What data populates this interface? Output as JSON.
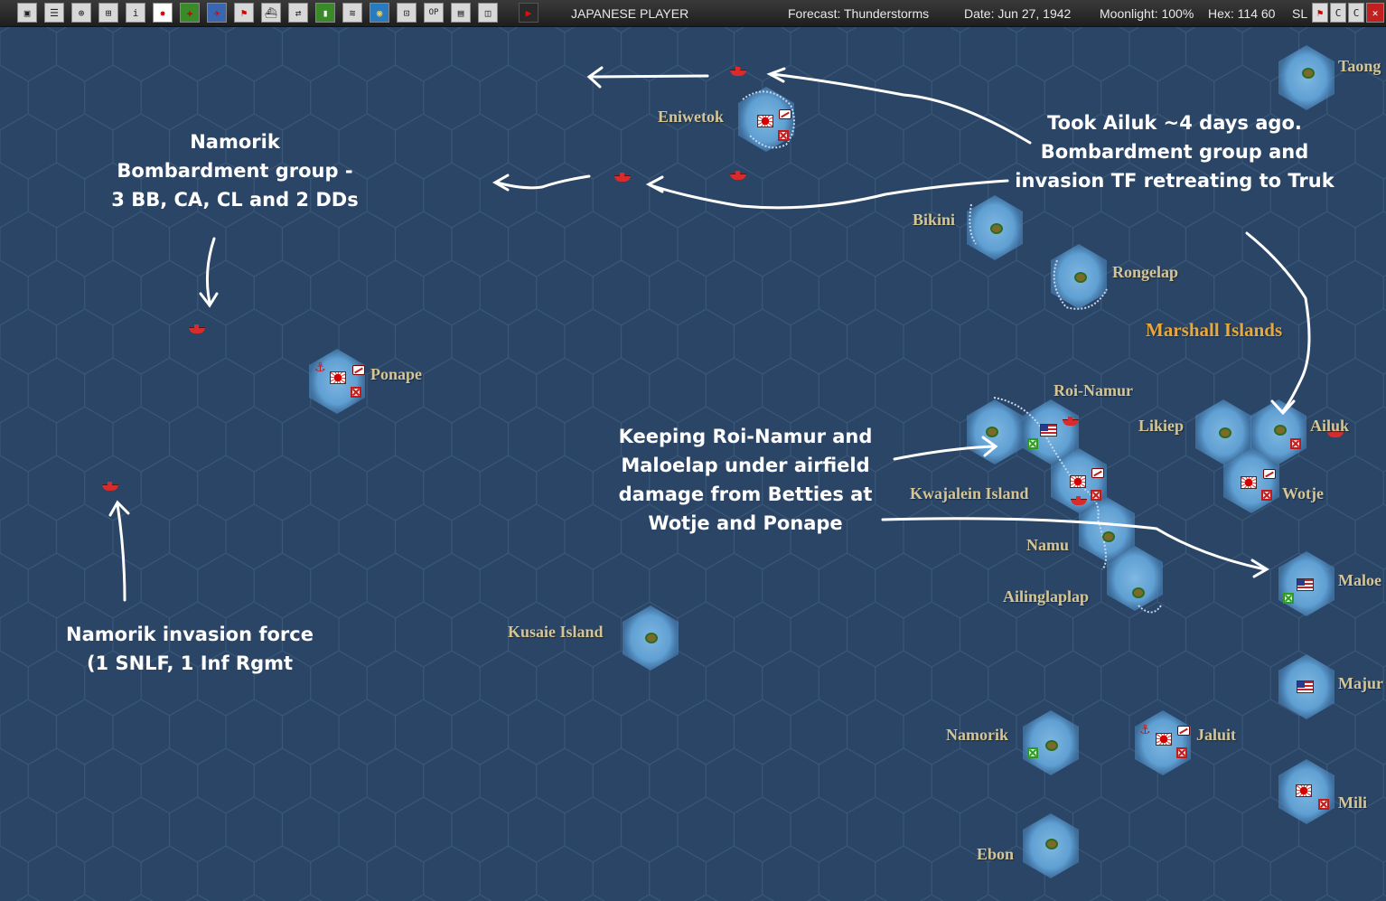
{
  "toolbar": {
    "player": "JAPANESE PLAYER",
    "forecast": "Forecast: Thunderstorms",
    "date": "Date: Jun 27, 1942",
    "moonlight": "Moonlight: 100%",
    "hex": "Hex: 114  60",
    "sl": "SL",
    "buttons": [
      "save",
      "report",
      "air",
      "ground",
      "info",
      "jp-flag",
      "air-group",
      "aircraft",
      "flag",
      "ship",
      "convoy",
      "chart",
      "fleet",
      "globe",
      "map",
      "op",
      "list",
      "window",
      "end-turn"
    ],
    "corner_icons": [
      "flag-icon",
      "c-icon",
      "c-icon",
      "close-icon"
    ]
  },
  "places": {
    "taong": "Taong",
    "eniwetok": "Eniwetok",
    "bikini": "Bikini",
    "rongelap": "Rongelap",
    "marshall": "Marshall Islands",
    "ponape": "Ponape",
    "roi_namur": "Roi-Namur",
    "likiep": "Likiep",
    "ailuk": "Ailuk",
    "kwajalein": "Kwajalein Island",
    "wotje": "Wotje",
    "namu": "Namu",
    "ailinglaplap": "Ailinglaplap",
    "maloe": "Maloe",
    "kusaie": "Kusaie Island",
    "majur": "Majur",
    "namorik": "Namorik",
    "jaluit": "Jaluit",
    "mili": "Mili",
    "ebon": "Ebon"
  },
  "notes": {
    "bombardment": [
      "Namorik",
      "Bombardment group -",
      "3 BB, CA, CL and 2 DDs"
    ],
    "ailuk": [
      "Took Ailuk ~4 days ago.",
      "Bombardment group and",
      "invasion TF retreating to Truk"
    ],
    "roi": [
      "Keeping Roi-Namur and",
      "Maloelap under airfield",
      "damage from Betties at",
      "Wotje and Ponape"
    ],
    "invasion": [
      "Namorik invasion force",
      "(1 SNLF, 1 Inf Rgmt"
    ]
  },
  "colors": {
    "ocean": "#2a4566",
    "hex_lines": "#3a5778",
    "island_glow": "#5f9fd2",
    "place_label": "#d5c595",
    "region_label": "#e8a83a",
    "japan_red": "#d92b2b",
    "annotation": "#ffffff"
  }
}
